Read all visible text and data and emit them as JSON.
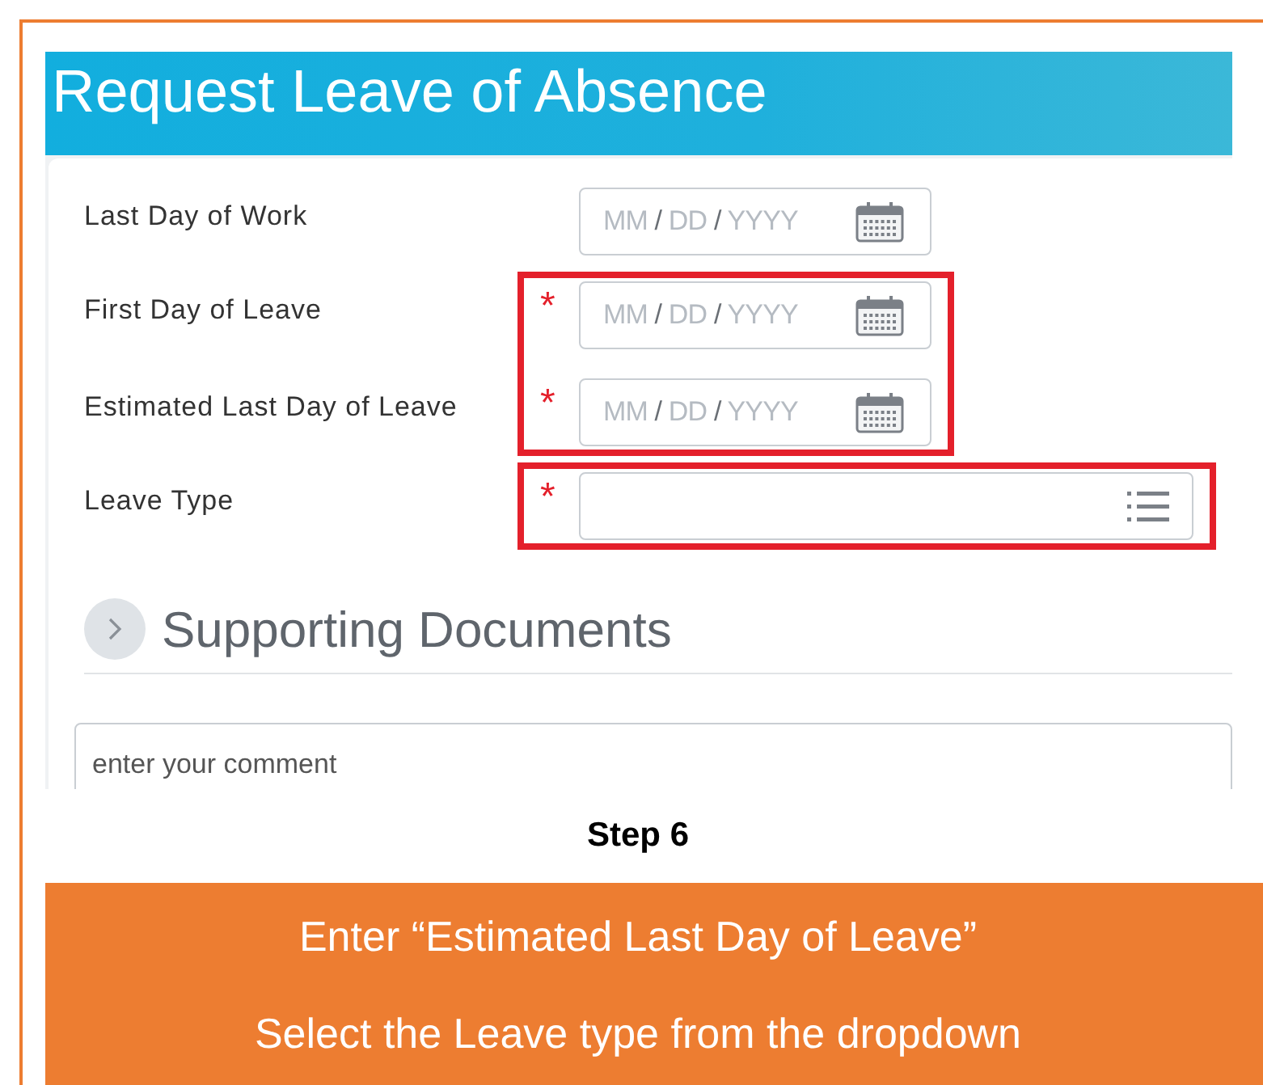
{
  "window": {
    "title": "Request Leave of Absence"
  },
  "field_groups": [
    {
      "highlighted": false,
      "fields": [
        {
          "label": "Last Day of Work",
          "required": false,
          "kind": "date",
          "placeholder": {
            "month": "MM",
            "day": "DD",
            "year": "YYYY",
            "separator": "/"
          }
        }
      ]
    },
    {
      "highlighted": true,
      "fields": [
        {
          "label": "First Day of Leave",
          "required": true,
          "kind": "date",
          "placeholder": {
            "month": "MM",
            "day": "DD",
            "year": "YYYY",
            "separator": "/"
          }
        },
        {
          "label": "Estimated Last Day of Leave",
          "required": true,
          "kind": "date",
          "placeholder": {
            "month": "MM",
            "day": "DD",
            "year": "YYYY",
            "separator": "/"
          }
        }
      ]
    },
    {
      "highlighted": true,
      "fields": [
        {
          "label": "Leave Type",
          "required": true,
          "kind": "select"
        }
      ]
    }
  ],
  "required_mark": "*",
  "section": {
    "title": "Supporting Documents",
    "expanded": false
  },
  "comment": {
    "placeholder": "enter your comment"
  },
  "step": {
    "title": "Step 6",
    "instructions": [
      "Enter “Estimated Last Day of Leave”",
      "Select the Leave type from the dropdown"
    ]
  }
}
